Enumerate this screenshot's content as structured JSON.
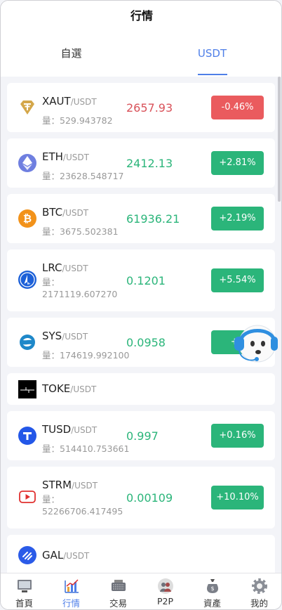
{
  "header": {
    "title": "行情"
  },
  "tabs": [
    {
      "label": "自選"
    },
    {
      "label": "USDT"
    }
  ],
  "vol_label": "量：",
  "markets": [
    {
      "base": "XAUT",
      "quote": "/USDT",
      "vol": "529.943782",
      "price": "2657.93",
      "change": "-0.46%",
      "dir": "down",
      "icon": "tether-gold-icon"
    },
    {
      "base": "ETH",
      "quote": "/USDT",
      "vol": "23628.548717",
      "price": "2412.13",
      "change": "+2.81%",
      "dir": "up",
      "icon": "ethereum-icon"
    },
    {
      "base": "BTC",
      "quote": "/USDT",
      "vol": "3675.502381",
      "price": "61936.21",
      "change": "+2.19%",
      "dir": "up",
      "icon": "bitcoin-icon"
    },
    {
      "base": "LRC",
      "quote": "/USDT",
      "vol": "2171119.607270",
      "price": "0.1201",
      "change": "+5.54%",
      "dir": "up",
      "icon": "loopring-icon"
    },
    {
      "base": "SYS",
      "quote": "/USDT",
      "vol": "174619.992100",
      "price": "0.0958",
      "change": "+5",
      "dir": "up",
      "icon": "syscoin-icon"
    },
    {
      "base": "TOKE",
      "quote": "/USDT",
      "icon": "toke-icon"
    },
    {
      "base": "TUSD",
      "quote": "/USDT",
      "vol": "514410.753661",
      "price": "0.997",
      "change": "+0.16%",
      "dir": "up",
      "icon": "trueusd-icon"
    },
    {
      "base": "STRM",
      "quote": "/USDT",
      "vol": "52266706.417495",
      "price": "0.00109",
      "change": "+10.10%",
      "dir": "up",
      "icon": "streamcoin-icon"
    },
    {
      "base": "GAL",
      "quote": "/USDT",
      "icon": "galxe-icon"
    }
  ],
  "nav": [
    {
      "label": "首頁",
      "icon": "home-icon"
    },
    {
      "label": "行情",
      "icon": "market-chart-icon",
      "active": true
    },
    {
      "label": "交易",
      "icon": "trade-keyboard-icon"
    },
    {
      "label": "P2P",
      "icon": "p2p-people-icon"
    },
    {
      "label": "資產",
      "icon": "asset-bag-icon"
    },
    {
      "label": "我的",
      "icon": "profile-gear-icon"
    }
  ],
  "colors": {
    "accent": "#4f7fe8",
    "up": "#2bb57a",
    "down": "#ea5b5e"
  }
}
